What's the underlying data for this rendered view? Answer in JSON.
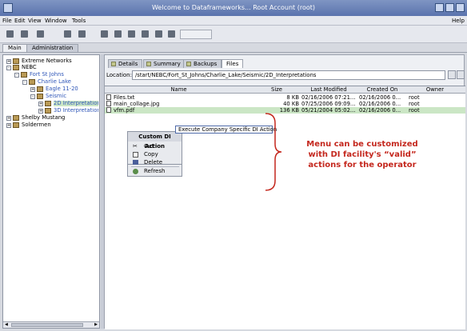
{
  "window": {
    "title": "Welcome to Dataframeworks... Root Account (root)"
  },
  "menu": {
    "items": [
      "File",
      "Edit",
      "View",
      "Window",
      "Tools"
    ],
    "help": "Help"
  },
  "main_tabs": [
    "Main",
    "Administration"
  ],
  "tree": {
    "items": [
      {
        "label": "Extreme Networks"
      },
      {
        "label": "NEBC"
      },
      {
        "label": "Fort St Johns"
      },
      {
        "label": "Charlie Lake"
      },
      {
        "label": "Eagle 11-20"
      },
      {
        "label": "Seismic"
      },
      {
        "label": "2D Interpretation"
      },
      {
        "label": "3D Interpretation"
      },
      {
        "label": "Shelby Mustang"
      },
      {
        "label": "Soldermen"
      }
    ]
  },
  "sub_tabs": [
    "Details",
    "Summary",
    "Backups",
    "Files"
  ],
  "location": {
    "label": "Location:",
    "value": "/start/NEBC/Fort_St_Johns/Charlie_Lake/Seismic/2D_Interpretations"
  },
  "table": {
    "headers": [
      "Name",
      "Size",
      "Last Modified",
      "Created On",
      "Owner"
    ],
    "rows": [
      {
        "name": "Files.txt",
        "size": "8 KB",
        "modified": "02/16/2006 07:21...",
        "created": "02/16/2006 0...",
        "owner": "root"
      },
      {
        "name": "main_collage.jpg",
        "size": "40 KB",
        "modified": "07/25/2006 09:09...",
        "created": "02/16/2006 0...",
        "owner": "root"
      },
      {
        "name": "vfm.pdf",
        "size": "136 KB",
        "modified": "05/21/2004 05:02...",
        "created": "02/16/2006 0...",
        "owner": "root"
      }
    ]
  },
  "context_menu": {
    "header": "Custom DI Action",
    "items": [
      "Cut",
      "Copy",
      "Delete",
      "Refresh"
    ],
    "submenu_item": "Execute Company Specific DI Action"
  },
  "annotation": {
    "lines": [
      "Menu can be customized",
      "with DI facility's “valid”",
      "actions for the operator"
    ],
    "color": "#c4271d"
  }
}
